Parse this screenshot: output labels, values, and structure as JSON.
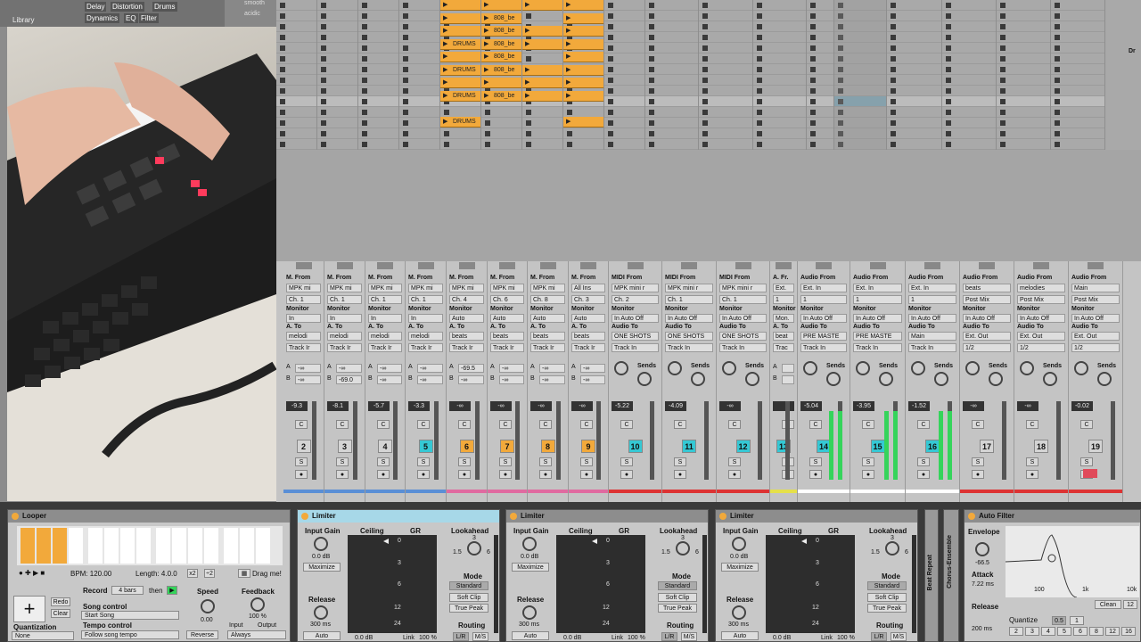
{
  "browser": {
    "library_label": "Library",
    "tags": [
      "Delay",
      "Distortion",
      "Drums",
      "Dynamics",
      "EQ",
      "Filter"
    ],
    "list_items": [
      "smooth",
      "acidic"
    ]
  },
  "colors": {
    "clip": "#f2a93b",
    "cyan": "#35c8d4",
    "orange": "#f2a93b",
    "meter": "#35d45b",
    "accent": "#4c9fd0"
  },
  "clips": {
    "drums": "DRUMS",
    "bass": "808_be"
  },
  "side_label": "Dr",
  "channels": [
    {
      "row1": "M. From",
      "from": "MPK mi",
      "ch": "Ch. 1",
      "mon": "In",
      "ato": "A. To",
      "to": "melodi",
      "out": "Track Ir",
      "send_a": "-∞",
      "send_b": "-∞",
      "vol": "-9.3",
      "num": "2",
      "numcolor": "plain",
      "bar": "#5a8fd6"
    },
    {
      "row1": "M. From",
      "from": "MPK mi",
      "ch": "Ch. 1",
      "mon": "In",
      "ato": "A. To",
      "to": "melodi",
      "out": "Track Ir",
      "send_a": "-∞",
      "send_b": "-69.0",
      "vol": "-8.1",
      "num": "3",
      "numcolor": "plain",
      "bar": "#5a8fd6"
    },
    {
      "row1": "M. From",
      "from": "MPK mi",
      "ch": "Ch. 1",
      "mon": "In",
      "ato": "A. To",
      "to": "melodi",
      "out": "Track Ir",
      "send_a": "-∞",
      "send_b": "-∞",
      "vol": "-5.7",
      "num": "4",
      "numcolor": "plain",
      "bar": "#5a8fd6"
    },
    {
      "row1": "M. From",
      "from": "MPK mi",
      "ch": "Ch. 1",
      "mon": "In",
      "ato": "A. To",
      "to": "melodi",
      "out": "Track Ir",
      "send_a": "-∞",
      "send_b": "-∞",
      "vol": "-3.3",
      "num": "5",
      "numcolor": "cyan",
      "bar": "#5a8fd6"
    },
    {
      "row1": "M. From",
      "from": "MPK mi",
      "ch": "Ch. 4",
      "mon": "Auto",
      "ato": "A. To",
      "to": "beats",
      "out": "Track Ir",
      "send_a": "-69.5",
      "send_b": "-∞",
      "vol": "-∞",
      "num": "6",
      "numcolor": "orange",
      "bar": "#e06aa0"
    },
    {
      "row1": "M. From",
      "from": "MPK mi",
      "ch": "Ch. 6",
      "mon": "Auto",
      "ato": "A. To",
      "to": "beats",
      "out": "Track Ir",
      "send_a": "-∞",
      "send_b": "-∞",
      "vol": "-∞",
      "num": "7",
      "numcolor": "orange",
      "bar": "#e06aa0"
    },
    {
      "row1": "M. From",
      "from": "MPK mi",
      "ch": "Ch. 8",
      "mon": "Auto",
      "ato": "A. To",
      "to": "beats",
      "out": "Track Ir",
      "send_a": "-∞",
      "send_b": "-∞",
      "vol": "-∞",
      "num": "8",
      "numcolor": "orange",
      "bar": "#e06aa0"
    },
    {
      "row1": "M. From",
      "from": "All Ins",
      "ch": "Ch. 3",
      "mon": "Auto",
      "ato": "A. To",
      "to": "beats",
      "out": "Track Ir",
      "send_a": "-∞",
      "send_b": "-∞",
      "vol": "-∞",
      "num": "9",
      "numcolor": "orange",
      "bar": "#e06aa0"
    },
    {
      "row1": "MIDI From",
      "from": "MPK mini r",
      "ch": "Ch. 2",
      "mon": "In  Auto  Off",
      "ato": "Audio To",
      "to": "ONE SHOTS",
      "out": "Track In",
      "send_a": "",
      "send_b": "",
      "vol": "-5.22",
      "num": "10",
      "numcolor": "cyan",
      "bar": "#d33"
    },
    {
      "row1": "MIDI From",
      "from": "MPK mini r",
      "ch": "Ch. 1",
      "mon": "In  Auto  Off",
      "ato": "Audio To",
      "to": "ONE SHOTS",
      "out": "Track In",
      "send_a": "",
      "send_b": "",
      "vol": "-4.09",
      "num": "11",
      "numcolor": "cyan",
      "bar": "#d33"
    },
    {
      "row1": "MIDI From",
      "from": "MPK mini r",
      "ch": "Ch. 1",
      "mon": "In  Auto  Off",
      "ato": "Audio To",
      "to": "ONE SHOTS",
      "out": "Track In",
      "send_a": "",
      "send_b": "",
      "vol": "-∞",
      "num": "12",
      "numcolor": "cyan",
      "bar": "#d33"
    },
    {
      "row1": "A. Fr.",
      "from": "Ext.",
      "ch": "1",
      "mon": "Mon.",
      "ato": "A. To",
      "to": "beat",
      "out": "Trac",
      "send_a": "",
      "send_b": "",
      "vol": "",
      "num": "13",
      "numcolor": "cyan",
      "bar": "#e5e04a"
    },
    {
      "row1": "Audio From",
      "from": "Ext. In",
      "ch": "1",
      "mon": "In  Auto  Off",
      "ato": "Audio To",
      "to": "PRE MASTE",
      "out": "Track In",
      "send_a": "",
      "send_b": "",
      "vol": "-5.04",
      "num": "14",
      "numcolor": "cyan",
      "bar": "#ffffff"
    },
    {
      "row1": "Audio From",
      "from": "Ext. In",
      "ch": "1",
      "mon": "In  Auto  Off",
      "ato": "Audio To",
      "to": "PRE MASTE",
      "out": "Track In",
      "send_a": "",
      "send_b": "",
      "vol": "-3.95",
      "num": "15",
      "numcolor": "cyan",
      "bar": "#ffffff"
    },
    {
      "row1": "Audio From",
      "from": "Ext. In",
      "ch": "1",
      "mon": "In  Auto  Off",
      "ato": "Audio To",
      "to": "Main",
      "out": "Track In",
      "send_a": "",
      "send_b": "",
      "vol": "-1.52",
      "num": "16",
      "numcolor": "cyan",
      "bar": "#ffffff"
    },
    {
      "row1": "Audio From",
      "from": "beats",
      "ch": "Post Mix",
      "mon": "In  Auto  Off",
      "ato": "Audio To",
      "to": "Ext. Out",
      "out": "1/2",
      "send_a": "",
      "send_b": "",
      "vol": "-∞",
      "num": "17",
      "numcolor": "plain",
      "bar": "#d33"
    },
    {
      "row1": "Audio From",
      "from": "melodies",
      "ch": "Post Mix",
      "mon": "In  Auto  Off",
      "ato": "Audio To",
      "to": "Ext. Out",
      "out": "1/2",
      "send_a": "",
      "send_b": "",
      "vol": "-∞",
      "num": "18",
      "numcolor": "plain",
      "bar": "#d33"
    },
    {
      "row1": "Audio From",
      "from": "Main",
      "ch": "Post Mix",
      "mon": "In  Auto  Off",
      "ato": "Audio To",
      "to": "Ext. Out",
      "out": "1/2",
      "send_a": "",
      "send_b": "",
      "vol": "-0.02",
      "num": "19",
      "numcolor": "plain",
      "bar": "#d33"
    }
  ],
  "mixer": {
    "sends_label": "Sends",
    "a": "A",
    "b": "B",
    "c": "C",
    "s": "S"
  },
  "looper": {
    "title": "Looper",
    "bpm": "BPM: 120.00",
    "length": "Length: 4.0.0",
    "x2a": "x2",
    "x2b": "÷2",
    "drag": "Drag me!",
    "record_label": "Record",
    "record_val": "4 bars",
    "then": "then",
    "song_control_label": "Song control",
    "song_control_val": "Start Song",
    "tempo_control_label": "Tempo control",
    "tempo_control_val": "Follow song tempo",
    "speed_label": "Speed",
    "speed_val": "0.00",
    "reverse": "Reverse",
    "feedback_label": "Feedback",
    "feedback_val": "100 %",
    "input_label": "Input",
    "output_label": "Output",
    "always": "Always",
    "redo": "Redo",
    "clear": "Clear",
    "quantization_label": "Quantization",
    "quantization_val": "None",
    "plus": "+"
  },
  "limiters": [
    {
      "title": "Limiter",
      "input_gain_label": "Input Gain",
      "input_gain_val": "0.0 dB",
      "maximize": "Maximize",
      "release_label": "Release",
      "release_val": "300 ms",
      "auto": "Auto",
      "ceiling_label": "Ceiling",
      "gr_label": "GR",
      "scale": [
        "0",
        "3",
        "6",
        "12",
        "24"
      ],
      "ceiling_val": "0.0 dB",
      "link": "Link",
      "link_val": "100 %",
      "lookahead_label": "Lookahead",
      "lookahead_vals": [
        "1.5",
        "3",
        "6"
      ],
      "mode_label": "Mode",
      "modes": [
        "Standard",
        "Soft Clip",
        "True Peak"
      ],
      "routing_label": "Routing",
      "lr": "L/R",
      "ms": "M/S"
    },
    {
      "title": "Limiter",
      "input_gain_label": "Input Gain",
      "input_gain_val": "0.0 dB",
      "maximize": "Maximize",
      "release_label": "Release",
      "release_val": "300 ms",
      "auto": "Auto",
      "ceiling_label": "Ceiling",
      "gr_label": "GR",
      "scale": [
        "0",
        "3",
        "6",
        "12",
        "24"
      ],
      "ceiling_val": "0.0 dB",
      "link": "Link",
      "link_val": "100 %",
      "lookahead_label": "Lookahead",
      "lookahead_vals": [
        "1.5",
        "3",
        "6"
      ],
      "mode_label": "Mode",
      "modes": [
        "Standard",
        "Soft Clip",
        "True Peak"
      ],
      "routing_label": "Routing",
      "lr": "L/R",
      "ms": "M/S"
    },
    {
      "title": "Limiter",
      "input_gain_label": "Input Gain",
      "input_gain_val": "0.0 dB",
      "maximize": "Maximize",
      "release_label": "Release",
      "release_val": "300 ms",
      "auto": "Auto",
      "ceiling_label": "Ceiling",
      "gr_label": "GR",
      "scale": [
        "0",
        "3",
        "6",
        "12",
        "24"
      ],
      "ceiling_val": "0.0 dB",
      "link": "Link",
      "link_val": "100 %",
      "lookahead_label": "Lookahead",
      "lookahead_vals": [
        "1.5",
        "3",
        "6"
      ],
      "mode_label": "Mode",
      "modes": [
        "Standard",
        "Soft Clip",
        "True Peak"
      ],
      "routing_label": "Routing",
      "lr": "L/R",
      "ms": "M/S"
    }
  ],
  "beat_repeat": "Beat Repeat",
  "chorus": "Chorus-Ensemble",
  "autofilter": {
    "title": "Auto Filter",
    "envelope_label": "Envelope",
    "envelope_val": "-66.5",
    "attack_label": "Attack",
    "attack_val": "7.22 ms",
    "release_label": "Release",
    "release_val": "200 ms",
    "freq_100": "100",
    "freq_1k": "1k",
    "freq_10k": "10k",
    "clean": "Clean",
    "num12": "12",
    "quantize": "Quantize",
    "q_vals": [
      "0.5",
      "1",
      "2",
      "3",
      "4",
      "5",
      "6",
      "8",
      "12",
      "16"
    ]
  }
}
